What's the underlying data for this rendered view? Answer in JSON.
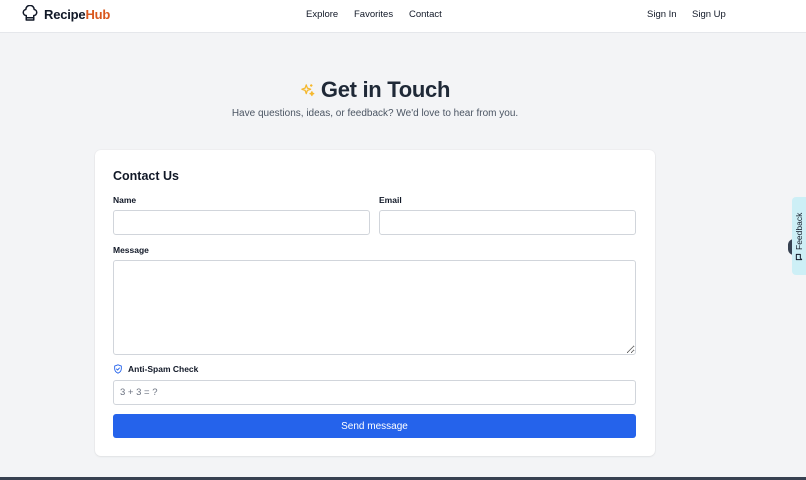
{
  "brand": {
    "name_part1": "Recipe",
    "name_part2": "Hub",
    "icon": "chef-hat-icon"
  },
  "nav": {
    "explore": "Explore",
    "favorites": "Favorites",
    "contact": "Contact"
  },
  "auth": {
    "sign_in": "Sign In",
    "sign_up": "Sign Up"
  },
  "hero": {
    "icon": "sparkles-icon",
    "title": "Get in Touch",
    "subtitle": "Have questions, ideas, or feedback? We'd love to hear from you."
  },
  "form": {
    "title": "Contact Us",
    "name_label": "Name",
    "name_value": "",
    "email_label": "Email",
    "email_value": "",
    "message_label": "Message",
    "message_value": "",
    "antispam_label": "Anti-Spam Check",
    "antispam_icon": "shield-check-icon",
    "antispam_placeholder": "3 + 3 = ?",
    "antispam_value": "",
    "submit_label": "Send message"
  },
  "feedback_tab": {
    "label": "Feedback",
    "icon": "message-icon"
  },
  "colors": {
    "brand_accent": "#d9571d",
    "primary": "#2563eb",
    "background": "#f3f4f6",
    "feedback_tab": "#cdeff6",
    "sparkle": "#f5b82e"
  }
}
